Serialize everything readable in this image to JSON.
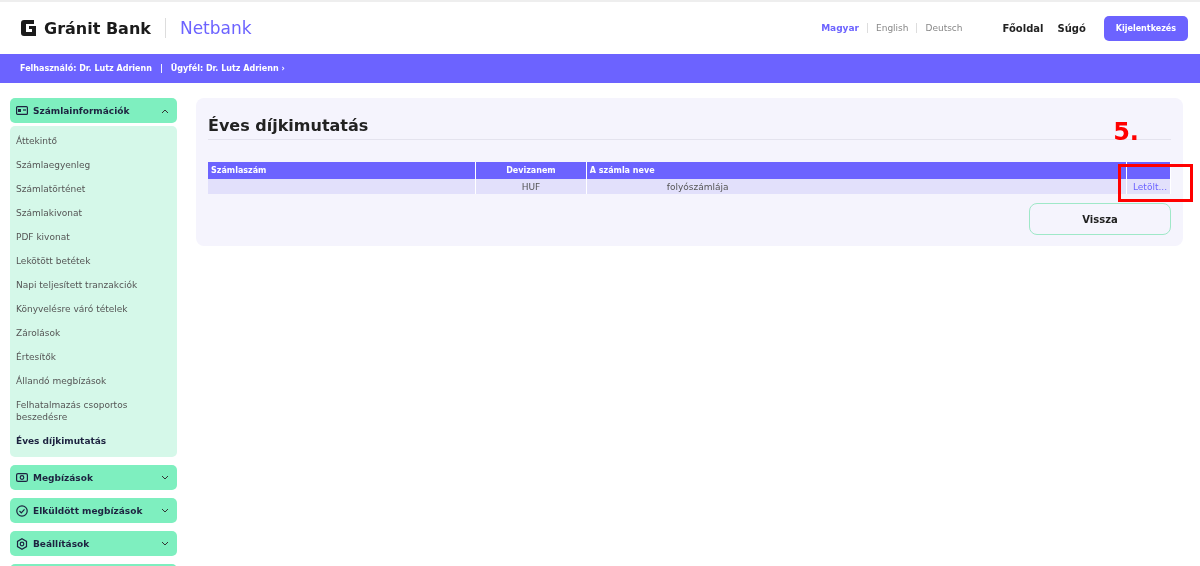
{
  "header": {
    "brand": "Gránit Bank",
    "product": "Netbank",
    "languages": [
      {
        "label": "Magyar",
        "selected": true
      },
      {
        "label": "English",
        "selected": false
      },
      {
        "label": "Deutsch",
        "selected": false
      }
    ],
    "nav": [
      "Főoldal",
      "Súgó"
    ],
    "logout": "Kijelentkezés"
  },
  "user_bar": {
    "user": "Felhasználó: Dr. Lutz Adrienn",
    "separator": "|",
    "client": "Ügyfél: Dr. Lutz Adrienn ›"
  },
  "sidebar": [
    {
      "label": "Számlainformációk",
      "kind": "card",
      "expanded": true,
      "items": [
        {
          "label": "Áttekintő",
          "selected": false
        },
        {
          "label": "Számlaegyenleg",
          "selected": false
        },
        {
          "label": "Számlatörténet",
          "selected": false
        },
        {
          "label": "Számlakivonat",
          "selected": false
        },
        {
          "label": "PDF kivonat",
          "selected": false
        },
        {
          "label": "Lekötött betétek",
          "selected": false
        },
        {
          "label": "Napi teljesített tranzakciók",
          "selected": false
        },
        {
          "label": "Könyvelésre váró tételek",
          "selected": false
        },
        {
          "label": "Zárolások",
          "selected": false
        },
        {
          "label": "Értesítők",
          "selected": false
        },
        {
          "label": "Állandó megbízások",
          "selected": false
        },
        {
          "label": "Felhatalmazás csoportos beszedésre",
          "selected": false
        },
        {
          "label": "Éves díjkimutatás",
          "selected": true
        }
      ]
    },
    {
      "label": "Megbízások",
      "kind": "money",
      "expanded": false
    },
    {
      "label": "Elküldött megbízások",
      "kind": "check",
      "expanded": false
    },
    {
      "label": "Beállítások",
      "kind": "gear",
      "expanded": false
    }
  ],
  "panel": {
    "title": "Éves díjkimutatás",
    "table": {
      "columns": [
        "Számlaszám",
        "Devizanem",
        "A számla neve"
      ],
      "rows": [
        {
          "cells": [
            "",
            "HUF",
            "folyószámlája"
          ],
          "link": "Letölt..."
        }
      ]
    },
    "back_button": "Vissza"
  },
  "annotation": {
    "label": "5."
  }
}
